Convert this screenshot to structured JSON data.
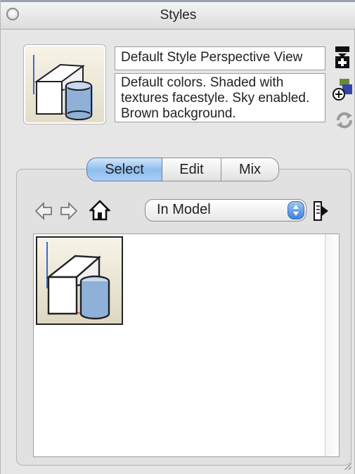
{
  "window": {
    "title": "Styles"
  },
  "current_style": {
    "name": "Default Style Perspective View",
    "description": "Default colors.  Shaded with textures facestyle.  Sky enabled.  Brown background."
  },
  "side_icons": [
    "style-details-icon",
    "create-style-icon",
    "update-style-icon"
  ],
  "tabs": [
    {
      "label": "Select",
      "active": true
    },
    {
      "label": "Edit",
      "active": false
    },
    {
      "label": "Mix",
      "active": false
    }
  ],
  "nav": {
    "icons": [
      "back-arrow-icon",
      "forward-arrow-icon",
      "home-icon",
      "details-icon"
    ],
    "collection": "In Model"
  },
  "colors": {
    "active_tab": "#8fbdf0",
    "stepper": "#3d82da",
    "model_box_blue": "#8fb0d8"
  }
}
